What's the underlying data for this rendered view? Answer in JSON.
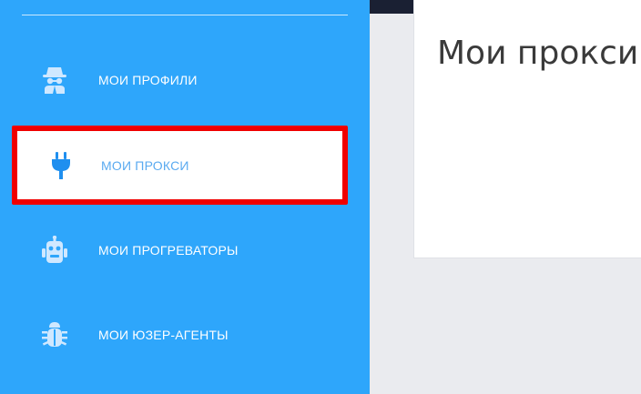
{
  "sidebar": {
    "items": [
      {
        "label": "МОИ ПРОФИЛИ",
        "icon": "spy-icon",
        "active": false
      },
      {
        "label": "МОИ ПРОКСИ",
        "icon": "plug-icon",
        "active": true
      },
      {
        "label": "МОИ ПРОГРЕВАТОРЫ",
        "icon": "robot-icon",
        "active": false
      },
      {
        "label": "МОИ ЮЗЕР-АГЕНТЫ",
        "icon": "bug-icon",
        "active": false
      }
    ]
  },
  "main": {
    "title": "Мои прокси"
  },
  "colors": {
    "sidebar_bg": "#2ea6fb",
    "highlight_border": "#f00000",
    "active_label": "#5aaaf0",
    "icon_light": "#cfe8ff",
    "active_icon": "#1f8fef"
  }
}
